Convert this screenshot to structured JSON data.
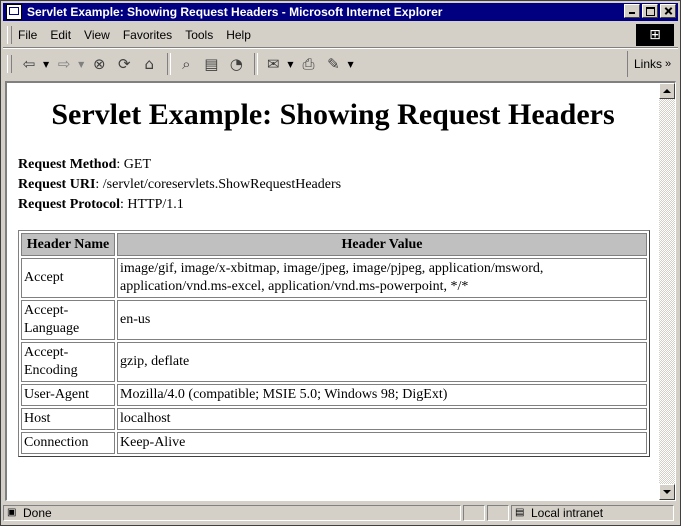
{
  "window": {
    "title": "Servlet Example: Showing Request Headers - Microsoft Internet Explorer"
  },
  "menu": {
    "items": [
      "File",
      "Edit",
      "View",
      "Favorites",
      "Tools",
      "Help"
    ]
  },
  "toolbar": {
    "icons": [
      "back-icon",
      "forward-icon",
      "stop-icon",
      "refresh-icon",
      "home-icon",
      "search-icon",
      "favorites-icon",
      "history-icon",
      "mail-icon",
      "print-icon",
      "edit-icon"
    ],
    "links_label": "Links"
  },
  "page": {
    "heading": "Servlet Example: Showing Request Headers",
    "request_method_label": "Request Method",
    "request_method_value": "GET",
    "request_uri_label": "Request URI",
    "request_uri_value": "/servlet/coreservlets.ShowRequestHeaders",
    "request_protocol_label": "Request Protocol",
    "request_protocol_value": "HTTP/1.1",
    "table": {
      "header_name": "Header Name",
      "header_value": "Header Value",
      "rows": [
        {
          "name": "Accept",
          "value": "image/gif, image/x-xbitmap, image/jpeg, image/pjpeg, application/msword, application/vnd.ms-excel, application/vnd.ms-powerpoint, */*"
        },
        {
          "name": "Accept-Language",
          "value": "en-us"
        },
        {
          "name": "Accept-Encoding",
          "value": "gzip, deflate"
        },
        {
          "name": "User-Agent",
          "value": "Mozilla/4.0 (compatible; MSIE 5.0; Windows 98; DigExt)"
        },
        {
          "name": "Host",
          "value": "localhost"
        },
        {
          "name": "Connection",
          "value": "Keep-Alive"
        }
      ]
    }
  },
  "status": {
    "text": "Done",
    "zone": "Local intranet"
  }
}
